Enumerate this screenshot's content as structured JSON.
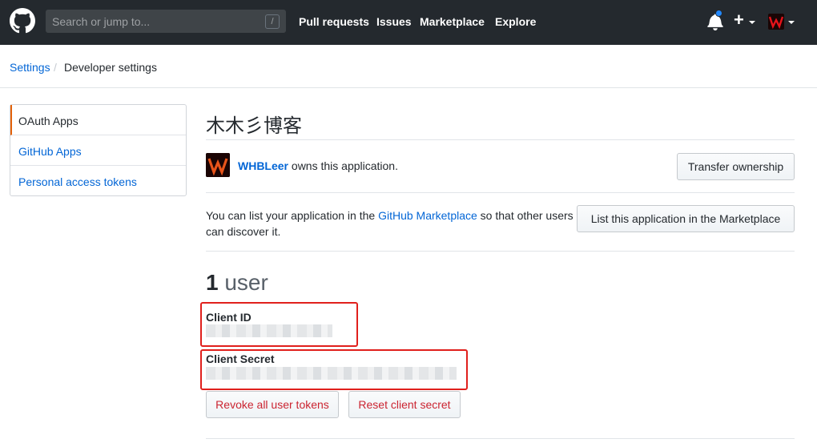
{
  "header": {
    "search_placeholder": "Search or jump to...",
    "search_key": "/",
    "nav": [
      "Pull requests",
      "Issues",
      "Marketplace",
      "Explore"
    ],
    "plus_symbol": "+"
  },
  "breadcrumb": {
    "root": "Settings",
    "separator": "/",
    "current": "Developer settings"
  },
  "side_menu": {
    "items": [
      {
        "label": "OAuth Apps",
        "selected": true
      },
      {
        "label": "GitHub Apps",
        "selected": false
      },
      {
        "label": "Personal access tokens",
        "selected": false
      }
    ]
  },
  "app": {
    "title": "木木彡博客",
    "owner_name": "WHBLeer",
    "owner_suffix": " owns this application.",
    "transfer_button": "Transfer ownership",
    "marketplace_text_prefix": "You can list your application in the ",
    "marketplace_link": "GitHub Marketplace",
    "marketplace_text_suffix": " so that other users can discover it.",
    "marketplace_button": "List this application in the Marketplace",
    "user_count": "1",
    "user_label": " user",
    "client_id_label": "Client ID",
    "client_secret_label": "Client Secret",
    "revoke_button": "Revoke all user tokens",
    "reset_button": "Reset client secret"
  },
  "colors": {
    "header_bg": "#24292e",
    "link": "#0366d6",
    "danger": "#cb2431",
    "highlight": "#e0201c",
    "selected_marker": "#e36209"
  }
}
